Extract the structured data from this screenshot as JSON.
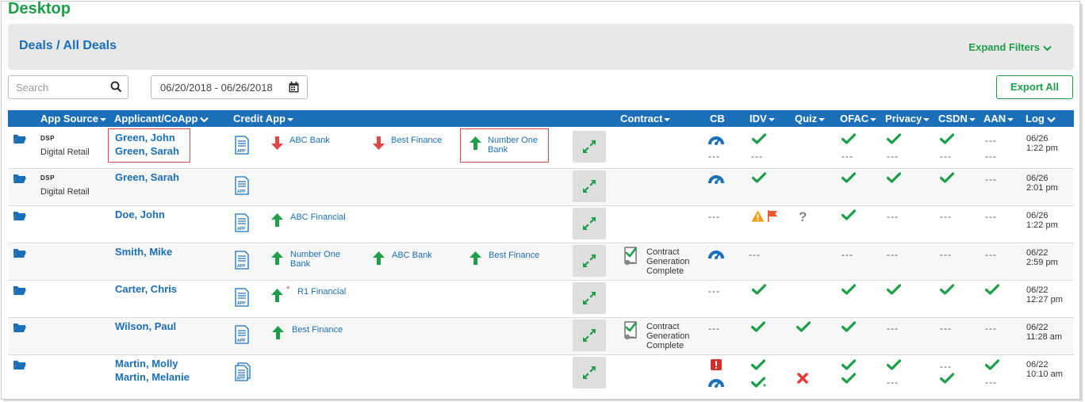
{
  "app": {
    "title": "Desktop"
  },
  "header": {
    "breadcrumb": "Deals / All Deals",
    "expand_filters": "Expand Filters"
  },
  "search": {
    "placeholder": "Search"
  },
  "date_range": {
    "value": "06/20/2018 - 06/26/2018"
  },
  "export": {
    "label": "Export All"
  },
  "columns": {
    "app_source": "App Source",
    "applicant": "Applicant/CoApp",
    "credit_app": "Credit App",
    "contract": "Contract",
    "cb": "CB",
    "idv": "IDV",
    "quiz": "Quiz",
    "ofac": "OFAC",
    "privacy": "Privacy",
    "csdn": "CSDN",
    "aan": "AAN",
    "log": "Log"
  },
  "colors": {
    "brand_green": "#1d9e48",
    "brand_blue": "#1a6fb8",
    "error_red": "#e04848",
    "warning_orange": "#f39c12"
  },
  "dash": "---",
  "rows": [
    {
      "source_tag": "DSP",
      "source": "Digital Retail",
      "applicant": "Green, John",
      "coapplicant": "Green, Sarah",
      "lenders": [
        {
          "name": "ABC Bank",
          "direction": "down"
        },
        {
          "name": "Best Finance",
          "direction": "down"
        },
        {
          "name": "Number One Bank",
          "direction": "up"
        }
      ],
      "log_date": "06/26",
      "log_time": "1:22 pm"
    },
    {
      "source_tag": "DSP",
      "source": "Digital Retail",
      "applicant": "Green, Sarah",
      "lenders": [],
      "log_date": "06/26",
      "log_time": "2:01 pm"
    },
    {
      "applicant": "Doe, John",
      "lenders": [
        {
          "name": "ABC Financial",
          "direction": "up"
        }
      ],
      "log_date": "06/26",
      "log_time": "1:22 pm"
    },
    {
      "applicant": "Smith, Mike",
      "lenders": [
        {
          "name": "Number One Bank",
          "direction": "up"
        },
        {
          "name": "ABC Bank",
          "direction": "up"
        },
        {
          "name": "Best Finance",
          "direction": "up"
        }
      ],
      "contract_status": "Contract Generation Complete",
      "log_date": "06/22",
      "log_time": "2:59 pm"
    },
    {
      "applicant": "Carter, Chris",
      "lenders": [
        {
          "name": "R1 Financial",
          "direction": "up",
          "flag": "*"
        }
      ],
      "log_date": "06/22",
      "log_time": "12:27 pm"
    },
    {
      "applicant": "Wilson, Paul",
      "lenders": [
        {
          "name": "Best Finance",
          "direction": "up"
        }
      ],
      "contract_status": "Contract Generation Complete",
      "log_date": "06/22",
      "log_time": "11:28 am"
    },
    {
      "applicant": "Martin, Molly",
      "coapplicant": "Martin, Melanie",
      "lenders": [],
      "log_date": "06/22",
      "log_time": "10:10 am"
    }
  ]
}
